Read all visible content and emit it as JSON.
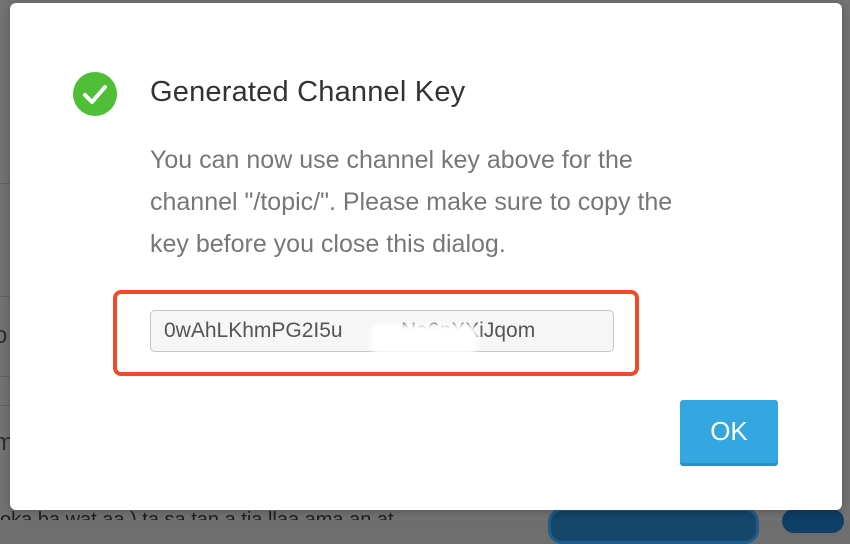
{
  "dialog": {
    "title": "Generated Channel Key",
    "message_lines": [
      "You can now use channel key above for the",
      "channel \"/topic/\". Please make sure to copy the",
      "key before you close this dialog."
    ],
    "key_value": "0wAhLKhmPG2I5u          Na6nXXiJqom",
    "ok_label": "OK",
    "status_icon": "check-circle-icon"
  },
  "background": {
    "partial_glyph_1": "o",
    "partial_glyph_2": "m",
    "bottom_text": "oka ba wat aa )   ta sa tan a  tia llaa ama  an at"
  },
  "colors": {
    "success": "#4fbf38",
    "button": "#34a6e0",
    "highlight": "#f04a2a",
    "title": "#333333",
    "message": "#777777"
  }
}
